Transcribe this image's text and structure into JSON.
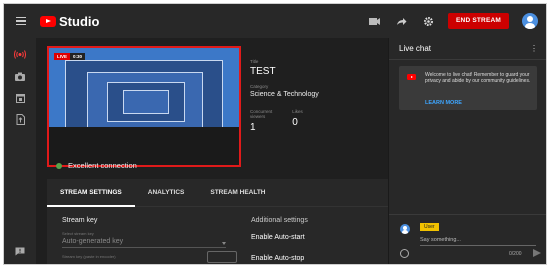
{
  "app": {
    "logo_text": "Studio"
  },
  "header": {
    "end_stream_label": "END STREAM",
    "icons": [
      "menu-icon",
      "camera-icon",
      "share-icon",
      "gear-icon",
      "avatar"
    ]
  },
  "rail": {
    "icons": [
      "live-icon",
      "camera-icon",
      "calendar-icon",
      "upload-icon",
      "feedback-icon"
    ]
  },
  "preview": {
    "live_label": "LIVE",
    "elapsed": "0:30",
    "connection": "Excellent connection"
  },
  "stream_info": {
    "title_label": "Title",
    "title": "TEST",
    "category_label": "Category",
    "category": "Science & Technology",
    "viewers_label": "Concurrent viewers",
    "viewers": "1",
    "likes_label": "Likes",
    "likes": "0"
  },
  "tabs": [
    {
      "label": "STREAM SETTINGS"
    },
    {
      "label": "ANALYTICS"
    },
    {
      "label": "STREAM HEALTH"
    }
  ],
  "stream_settings": {
    "stream_key_title": "Stream key",
    "select_label": "Select stream key",
    "select_value": "Auto-generated key",
    "second_label": "Stream key (paste in encoder)",
    "additional_title": "Additional settings",
    "auto_start": "Enable Auto-start",
    "auto_stop": "Enable Auto-stop"
  },
  "chat": {
    "title": "Live chat",
    "notice": "Welcome to live chat! Remember to guard your privacy and abide by our community guidelines.",
    "learn_more": "LEARN MORE",
    "user_name": "User",
    "placeholder": "Say something...",
    "char_count": "0/200"
  },
  "colors": {
    "accent_red": "#cc0000",
    "link_blue": "#3ea6ff",
    "user_tag": "#f2c200"
  }
}
